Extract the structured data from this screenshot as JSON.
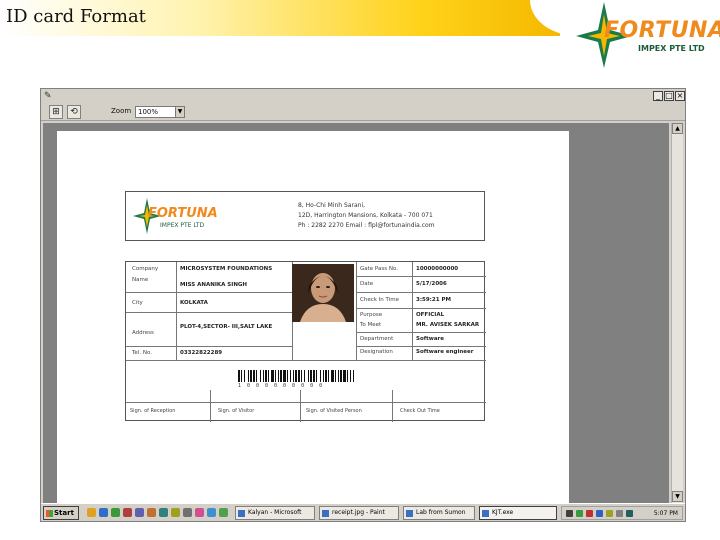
{
  "slide": {
    "title": "ID card Format",
    "logo": {
      "word": "FORTUNA",
      "sub": "IMPEX PTE LTD"
    }
  },
  "window": {
    "toolbar": {
      "zoom_label": "Zoom",
      "zoom_value": "100%"
    }
  },
  "card": {
    "logo_word": "FORTUNA",
    "logo_sub": "IMPEX PTE LTD",
    "address_lines": [
      "8, Ho-Chi Minh Sarani,",
      "12D, Harrington Mansions, Kolkata - 700 071",
      "Ph : 2282 2270   Email : flpl@fortunaindia.com"
    ],
    "left_fields": [
      {
        "label": "Company",
        "value": "MICROSYSTEM FOUNDATIONS"
      },
      {
        "label": "Name",
        "value": "MISS ANANIKA SINGH"
      },
      {
        "label": "City",
        "value": "KOLKATA"
      },
      {
        "label": "Address",
        "value": "PLOT-4,SECTOR- III,SALT LAKE"
      },
      {
        "label": "Tel. No.",
        "value": "03322822289"
      }
    ],
    "right_fields": [
      {
        "label": "Gate Pass No.",
        "value": "10000000000"
      },
      {
        "label": "Date",
        "value": "5/17/2006"
      },
      {
        "label": "Check In Time",
        "value": "3:59:21 PM"
      },
      {
        "label": "Purpose",
        "value": "OFFICIAL"
      },
      {
        "label": "To Meet",
        "value": "MR. AVISEK SARKAR"
      },
      {
        "label": "Department",
        "value": "Software"
      },
      {
        "label": "Designation",
        "value": "Software engineer"
      }
    ],
    "barcode_digits": "1000000000",
    "signatures": [
      "Sign. of Reception",
      "Sign. of Visitor",
      "Sign. of Visited Person",
      "Check Out Time"
    ]
  },
  "taskbar": {
    "start_label": "Start",
    "tasks": [
      {
        "label": "Kalyan - Microsoft"
      },
      {
        "label": "receipt.jpg - Paint"
      },
      {
        "label": "Lab from Sumon"
      },
      {
        "label": "KJT.exe"
      }
    ],
    "clock": "5:07 PM"
  }
}
